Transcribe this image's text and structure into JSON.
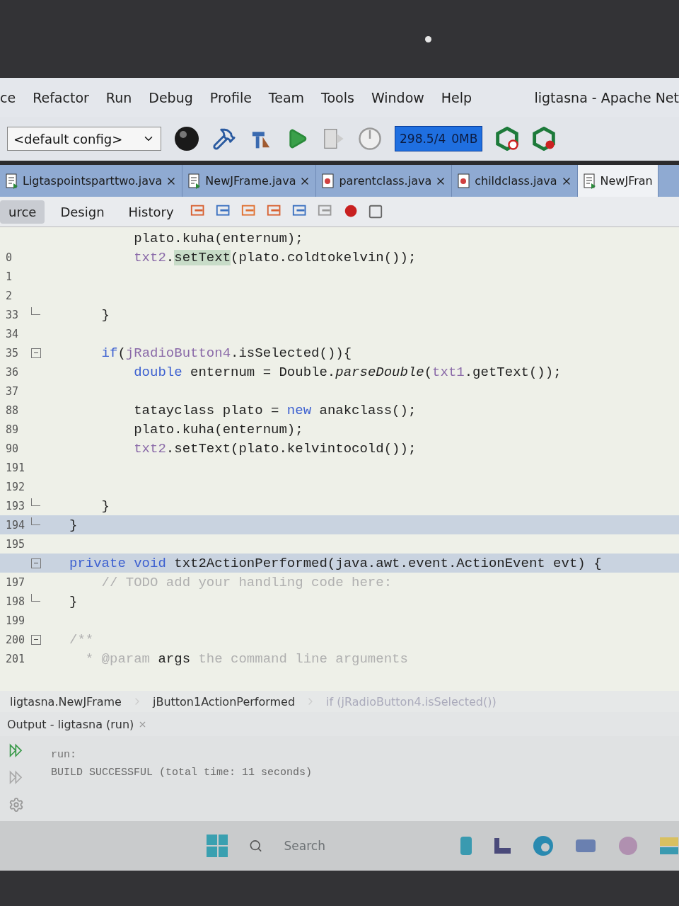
{
  "menu_bar": {
    "items": [
      "ce",
      "Refactor",
      "Run",
      "Debug",
      "Profile",
      "Team",
      "Tools",
      "Window",
      "Help"
    ],
    "title": "ligtasna - Apache Net"
  },
  "toolbar": {
    "config": "<default config>",
    "memory": [
      "298.5/4",
      "0MB"
    ]
  },
  "tabs": [
    {
      "label": "Ligtaspointsparttwo.java",
      "selected": false,
      "kind": "form"
    },
    {
      "label": "NewJFrame.java",
      "selected": false,
      "kind": "form"
    },
    {
      "label": "parentclass.java",
      "selected": false,
      "kind": "class"
    },
    {
      "label": "childclass.java",
      "selected": false,
      "kind": "class"
    },
    {
      "label": "NewJFran",
      "selected": true,
      "kind": "form"
    }
  ],
  "view_tabs": [
    {
      "label": "urce",
      "selected": true
    },
    {
      "label": "Design",
      "selected": false
    },
    {
      "label": "History",
      "selected": false
    }
  ],
  "code_lines": [
    {
      "highlighted": false,
      "collapsible": false,
      "block_end": false,
      "segments": [
        {
          "text": "        plato.kuha(enternum);",
          "kind": "plain"
        }
      ]
    },
    {
      "number": "0",
      "highlighted": false,
      "collapsible": false,
      "block_end": false,
      "segments": [
        {
          "text": "        txt2",
          "kind": "field"
        },
        {
          "text": ".",
          "kind": "plain"
        },
        {
          "text": "setText",
          "kind": "mark"
        },
        {
          "text": "(plato.coldtokelvin());",
          "kind": "plain"
        }
      ]
    },
    {
      "number": "1",
      "highlighted": false,
      "collapsible": false,
      "block_end": false
    },
    {
      "number": "2",
      "highlighted": false,
      "collapsible": false,
      "block_end": false
    },
    {
      "number": "33",
      "highlighted": false,
      "collapsible": false,
      "block_end": true,
      "segments": [
        {
          "text": "    }",
          "kind": "plain"
        }
      ]
    },
    {
      "number": "34",
      "highlighted": false,
      "collapsible": false,
      "block_end": false
    },
    {
      "number": "35",
      "highlighted": false,
      "collapsible": true,
      "block_end": false,
      "segments": [
        {
          "text": "    if",
          "kind": "keyword"
        },
        {
          "text": "(",
          "kind": "plain"
        },
        {
          "text": "jRadioButton4",
          "kind": "field"
        },
        {
          "text": ".isSelected()){",
          "kind": "plain"
        }
      ]
    },
    {
      "number": "36",
      "highlighted": false,
      "collapsible": false,
      "block_end": false,
      "segments": [
        {
          "text": "        double",
          "kind": "keyword"
        },
        {
          "text": " enternum = Double.",
          "kind": "plain"
        },
        {
          "text": "parseDouble",
          "kind": "italic"
        },
        {
          "text": "(",
          "kind": "plain"
        },
        {
          "text": "txt1",
          "kind": "field"
        },
        {
          "text": ".getText());",
          "kind": "plain"
        }
      ]
    },
    {
      "number": "37",
      "highlighted": false,
      "collapsible": false,
      "block_end": false
    },
    {
      "number": "88",
      "highlighted": false,
      "collapsible": false,
      "block_end": false,
      "segments": [
        {
          "text": "        tatayclass plato = ",
          "kind": "plain"
        },
        {
          "text": "new",
          "kind": "keyword"
        },
        {
          "text": " anakclass();",
          "kind": "plain"
        }
      ]
    },
    {
      "number": "89",
      "highlighted": false,
      "collapsible": false,
      "block_end": false,
      "segments": [
        {
          "text": "        plato.kuha(enternum);",
          "kind": "plain"
        }
      ]
    },
    {
      "number": "90",
      "highlighted": false,
      "collapsible": false,
      "block_end": false,
      "segments": [
        {
          "text": "        txt2",
          "kind": "field"
        },
        {
          "text": ".setText(plato.kelvintocold());",
          "kind": "plain"
        }
      ]
    },
    {
      "number": "191",
      "highlighted": false,
      "collapsible": false,
      "block_end": false
    },
    {
      "number": "192",
      "highlighted": false,
      "collapsible": false,
      "block_end": false
    },
    {
      "number": "193",
      "highlighted": false,
      "collapsible": false,
      "block_end": true,
      "segments": [
        {
          "text": "    }",
          "kind": "plain"
        }
      ]
    },
    {
      "number": "194",
      "highlighted": true,
      "collapsible": false,
      "block_end": true,
      "segments": [
        {
          "text": "}",
          "kind": "plain"
        }
      ]
    },
    {
      "number": "195",
      "highlighted": false,
      "collapsible": false,
      "block_end": false
    },
    {
      "highlighted": true,
      "collapsible": true,
      "block_end": false,
      "segments": [
        {
          "text": "private void",
          "kind": "keyword"
        },
        {
          "text": " txt2ActionPerformed(java.awt.event.ActionEvent evt) {",
          "kind": "plain"
        }
      ]
    },
    {
      "number": "197",
      "highlighted": false,
      "collapsible": false,
      "block_end": false,
      "segments": [
        {
          "text": "    // TODO add your handling code here:",
          "kind": "comment"
        }
      ]
    },
    {
      "number": "198",
      "highlighted": false,
      "collapsible": false,
      "block_end": true,
      "segments": [
        {
          "text": "}",
          "kind": "plain"
        }
      ]
    },
    {
      "number": "199",
      "highlighted": false,
      "collapsible": false,
      "block_end": false
    },
    {
      "number": "200",
      "highlighted": false,
      "collapsible": true,
      "block_end": false,
      "segments": [
        {
          "text": "/**",
          "kind": "comment"
        }
      ]
    },
    {
      "number": "201",
      "highlighted": false,
      "collapsible": false,
      "block_end": false,
      "segments": [
        {
          "text": "  * @param ",
          "kind": "comment"
        },
        {
          "text": "args",
          "kind": "plain"
        },
        {
          "text": " the command line arguments",
          "kind": "comment"
        }
      ]
    }
  ],
  "breadcrumbs": [
    "ligtasna.NewJFrame",
    "jButton1ActionPerformed",
    "if (jRadioButton4.isSelected())"
  ],
  "output": {
    "title": "Output - ligtasna (run)",
    "lines": [
      "run:",
      "BUILD SUCCESSFUL (total time: 11 seconds)"
    ]
  },
  "taskbar": {
    "search": "Search"
  }
}
